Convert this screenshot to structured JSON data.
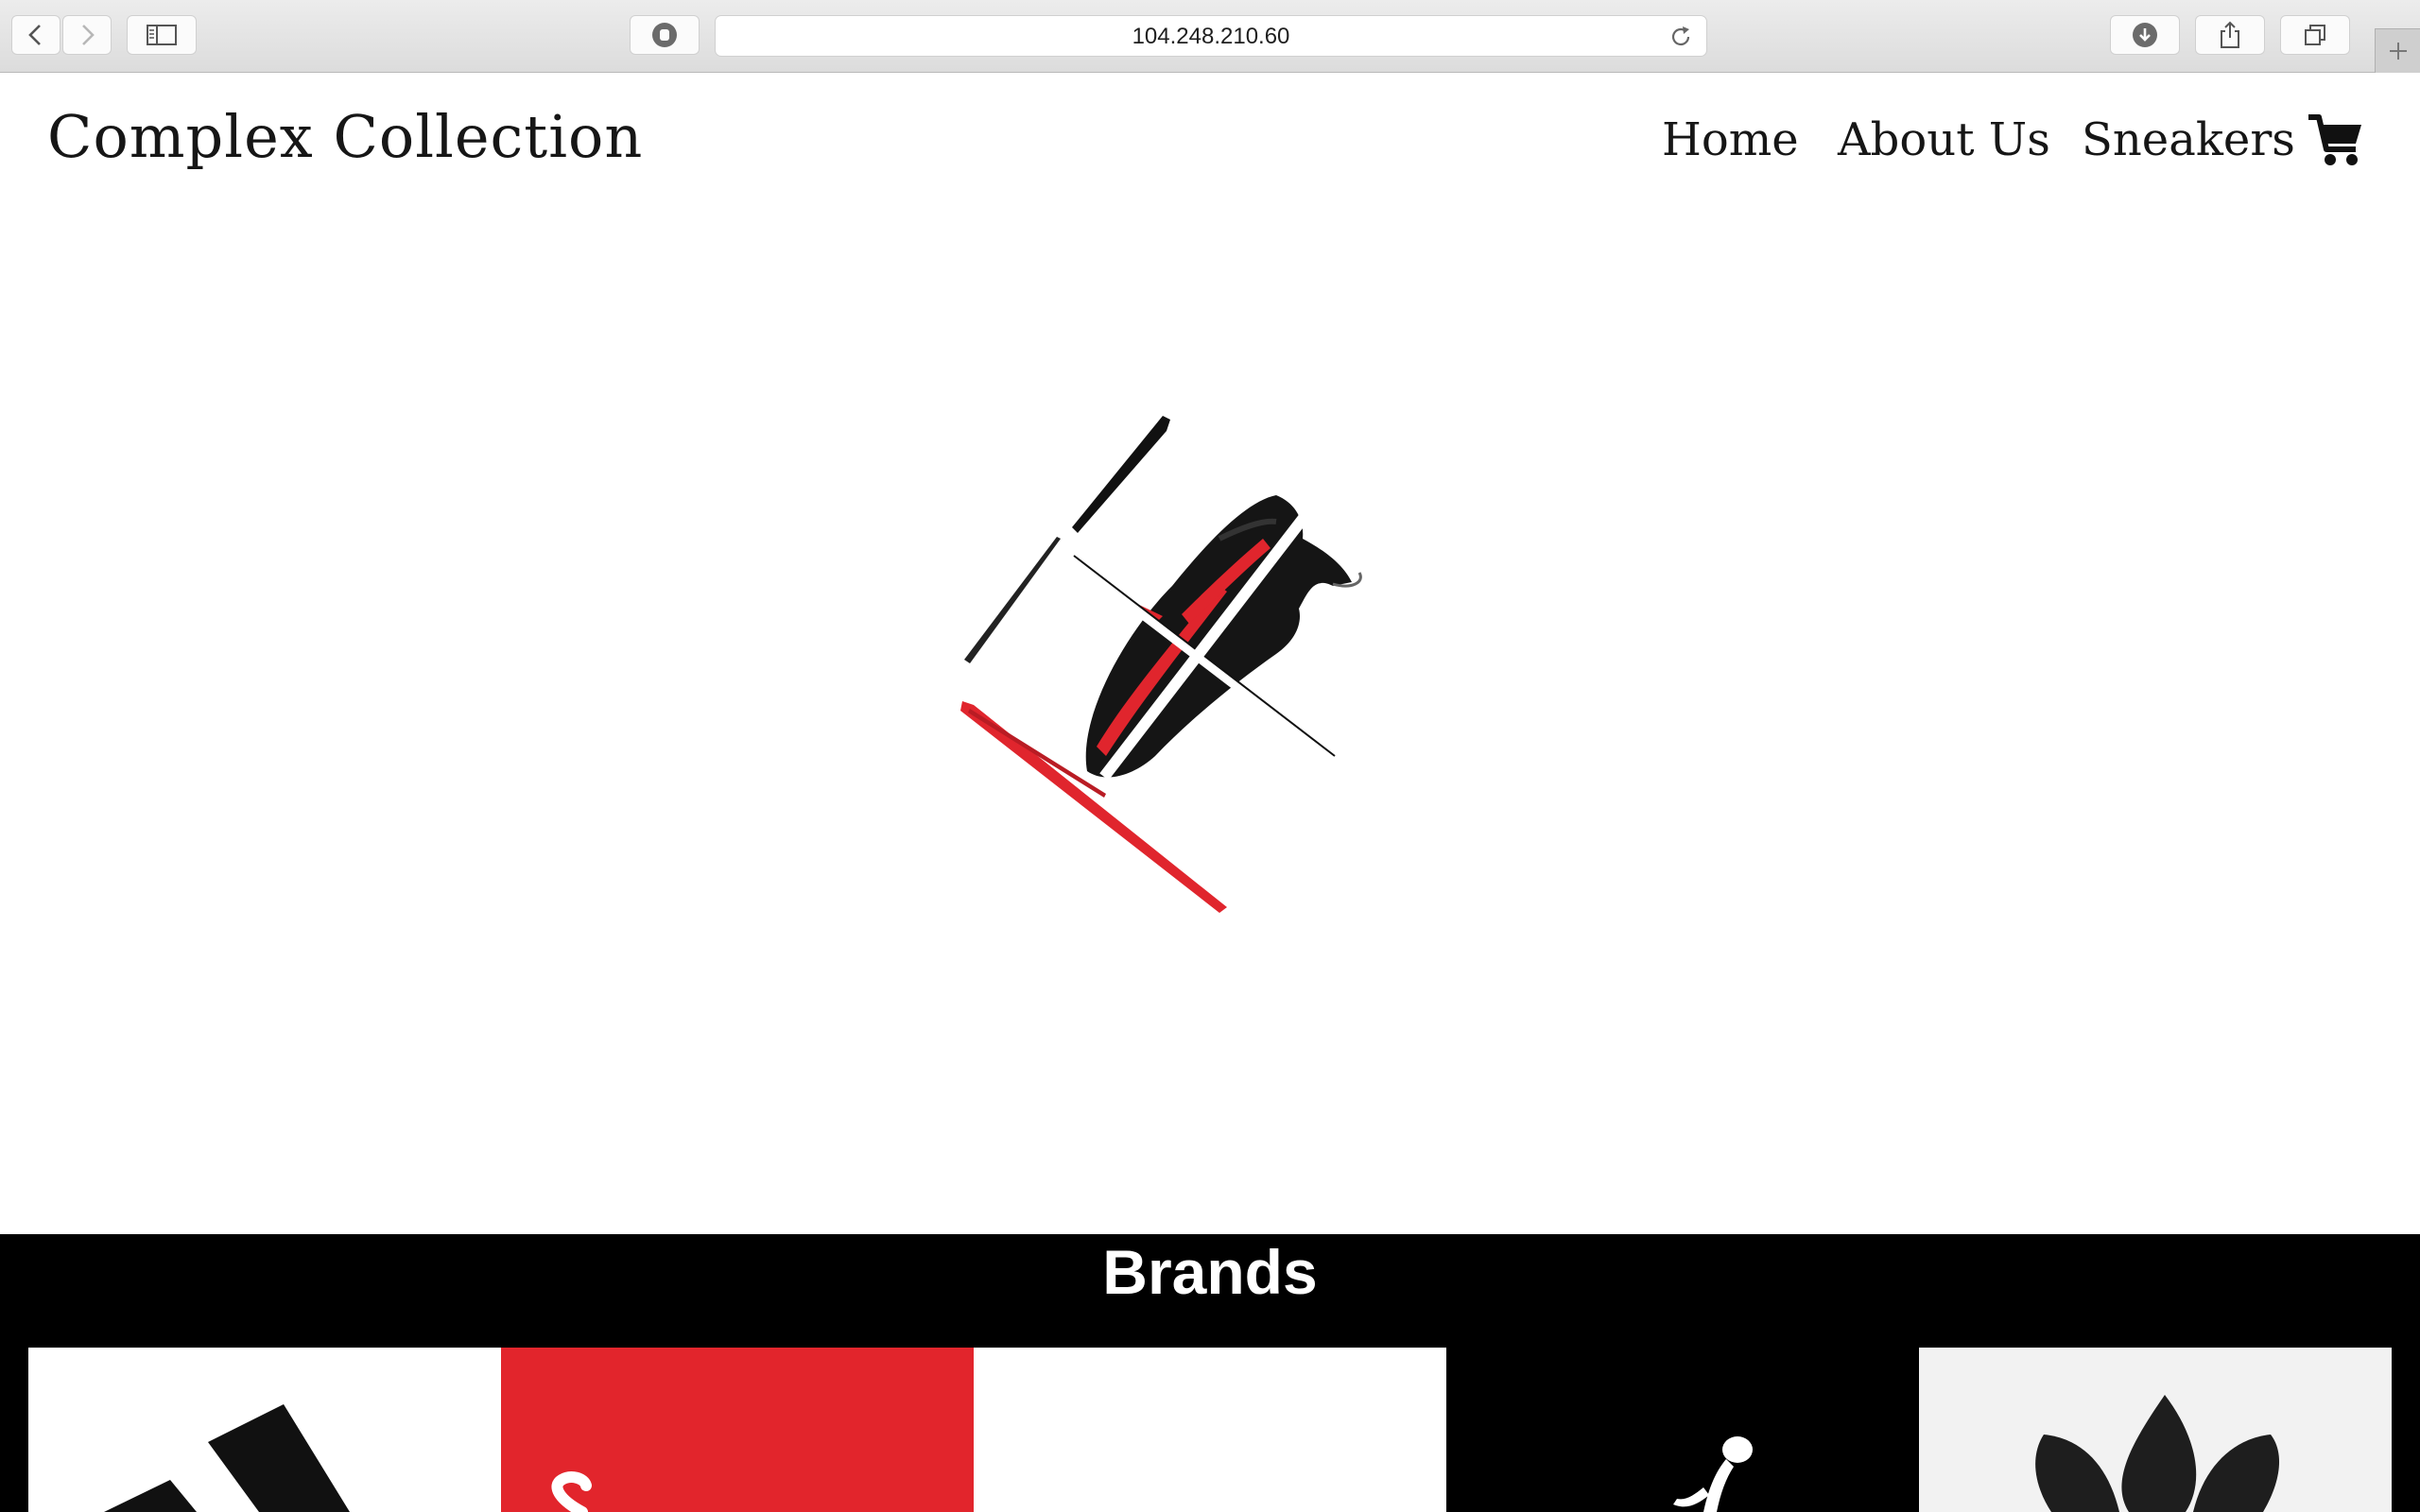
{
  "browser": {
    "url": "104.248.210.60",
    "icons": [
      "back-arrow-icon",
      "forward-arrow-icon",
      "sidebar-icon",
      "privacy-shield-icon",
      "reload-icon",
      "download-icon",
      "share-icon",
      "tabs-icon",
      "plus-icon"
    ]
  },
  "site": {
    "logo": "Complex Collection",
    "nav": {
      "home": "Home",
      "about": "About Us",
      "sneakers": "Sneakers",
      "cart_icon": "shopping-cart-icon"
    }
  },
  "hero": {
    "image": "sliced-sneaker-image",
    "colors": {
      "accent": "#e0252d",
      "dark": "#111111"
    }
  },
  "brands": {
    "title": "Brands",
    "tiles": [
      "brand-tile-1",
      "brand-tile-2",
      "brand-tile-3",
      "jumpman-logo",
      "trefoil-logo"
    ],
    "colors": {
      "red": "#e2252c",
      "black": "#000000",
      "white": "#ffffff",
      "light": "#f2f2f2"
    }
  }
}
